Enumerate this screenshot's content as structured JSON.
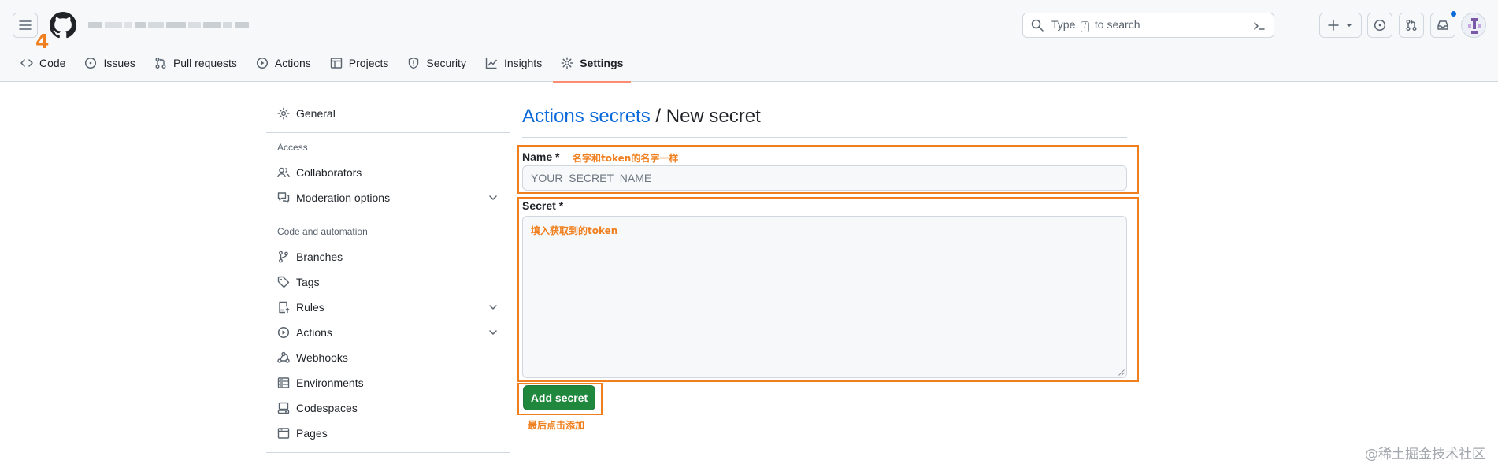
{
  "header": {
    "step_number": "4",
    "search": {
      "placeholder_before": "Type",
      "slash_key": "/",
      "placeholder_after": "to search"
    }
  },
  "tabs": [
    {
      "label": "Code",
      "icon": "code-icon"
    },
    {
      "label": "Issues",
      "icon": "issue-opened-icon"
    },
    {
      "label": "Pull requests",
      "icon": "git-pull-request-icon"
    },
    {
      "label": "Actions",
      "icon": "play-icon"
    },
    {
      "label": "Projects",
      "icon": "table-icon"
    },
    {
      "label": "Security",
      "icon": "shield-icon"
    },
    {
      "label": "Insights",
      "icon": "graph-icon"
    },
    {
      "label": "Settings",
      "icon": "gear-icon",
      "active": true
    }
  ],
  "sidebar": {
    "general": "General",
    "access_heading": "Access",
    "collaborators": "Collaborators",
    "moderation": "Moderation options",
    "automation_heading": "Code and automation",
    "branches": "Branches",
    "tags": "Tags",
    "rules": "Rules",
    "actions": "Actions",
    "webhooks": "Webhooks",
    "environments": "Environments",
    "codespaces": "Codespaces",
    "pages": "Pages"
  },
  "main": {
    "breadcrumb_link": "Actions secrets",
    "breadcrumb_sep": " / ",
    "title": "New secret",
    "name_label": "Name *",
    "name_placeholder": "YOUR_SECRET_NAME",
    "secret_label": "Secret *",
    "add_button": "Add secret"
  },
  "annotations": {
    "name_note": "名字和token的名字一样",
    "secret_note": "填入获取到的token",
    "button_note": "最后点击添加",
    "color": "#f0801f"
  },
  "watermark": "@稀土掘金技术社区",
  "colors": {
    "link": "#0969da",
    "primary_button": "#1f883d",
    "active_tab_underline": "#fd8c73"
  }
}
